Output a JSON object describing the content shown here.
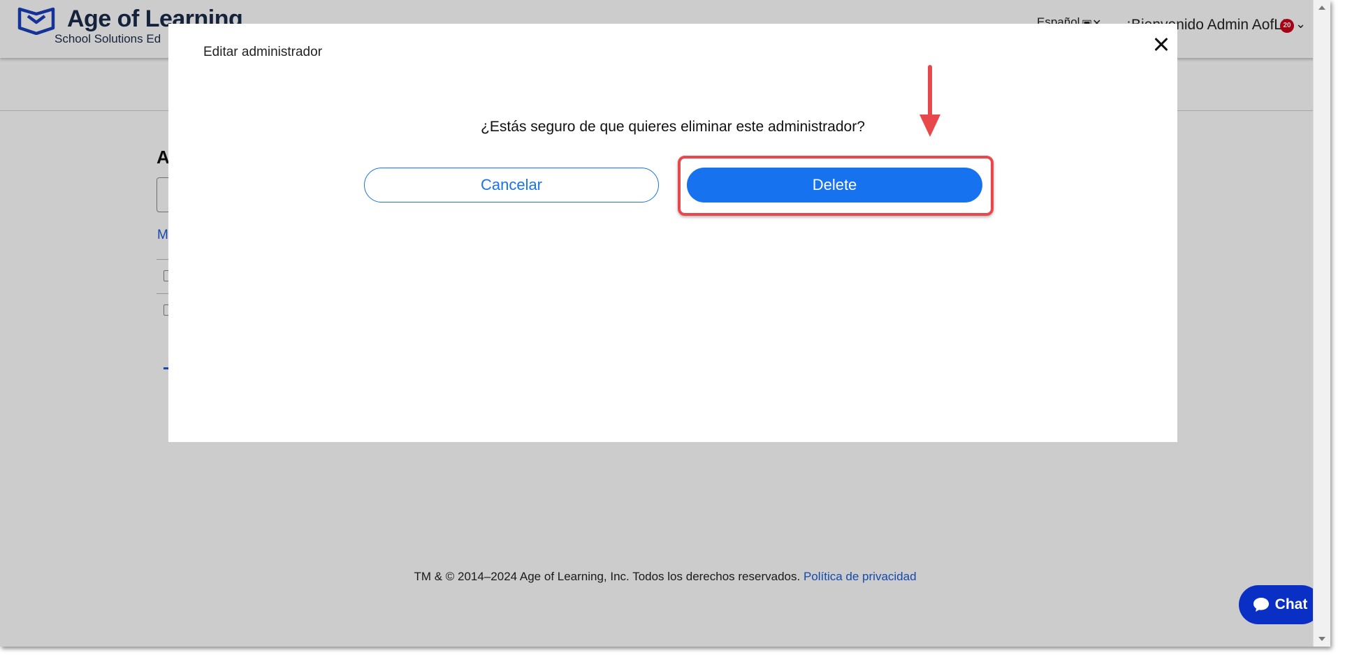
{
  "header": {
    "brand": "Age of Learning",
    "subtitle": "School Solutions Ed",
    "language": "Español",
    "welcome": "¡Bienvenido Admin AofL!",
    "notification_count": "20"
  },
  "page": {
    "section_heading": "A",
    "link_text": "M"
  },
  "modal": {
    "title": "Editar administrador",
    "question": "¿Estás seguro de que quieres eliminar este administrador?",
    "cancel_label": "Cancelar",
    "delete_label": "Delete"
  },
  "footer": {
    "copyright": "TM & © 2014–2024 Age of Learning, Inc. Todos los derechos reservados.",
    "privacy_link": "Política de privacidad"
  },
  "chat": {
    "label": "Chat"
  },
  "colors": {
    "primary": "#1672ef",
    "brand_navy": "#1b2b4a",
    "chat_blue": "#0a2fc4",
    "highlight_red": "#e8474c",
    "badge_red": "#d0021b"
  },
  "icons": {
    "logo": "book-shield-icon",
    "close": "close-icon",
    "chat": "speech-bubble-icon",
    "chevron": "chevron-down-icon"
  }
}
